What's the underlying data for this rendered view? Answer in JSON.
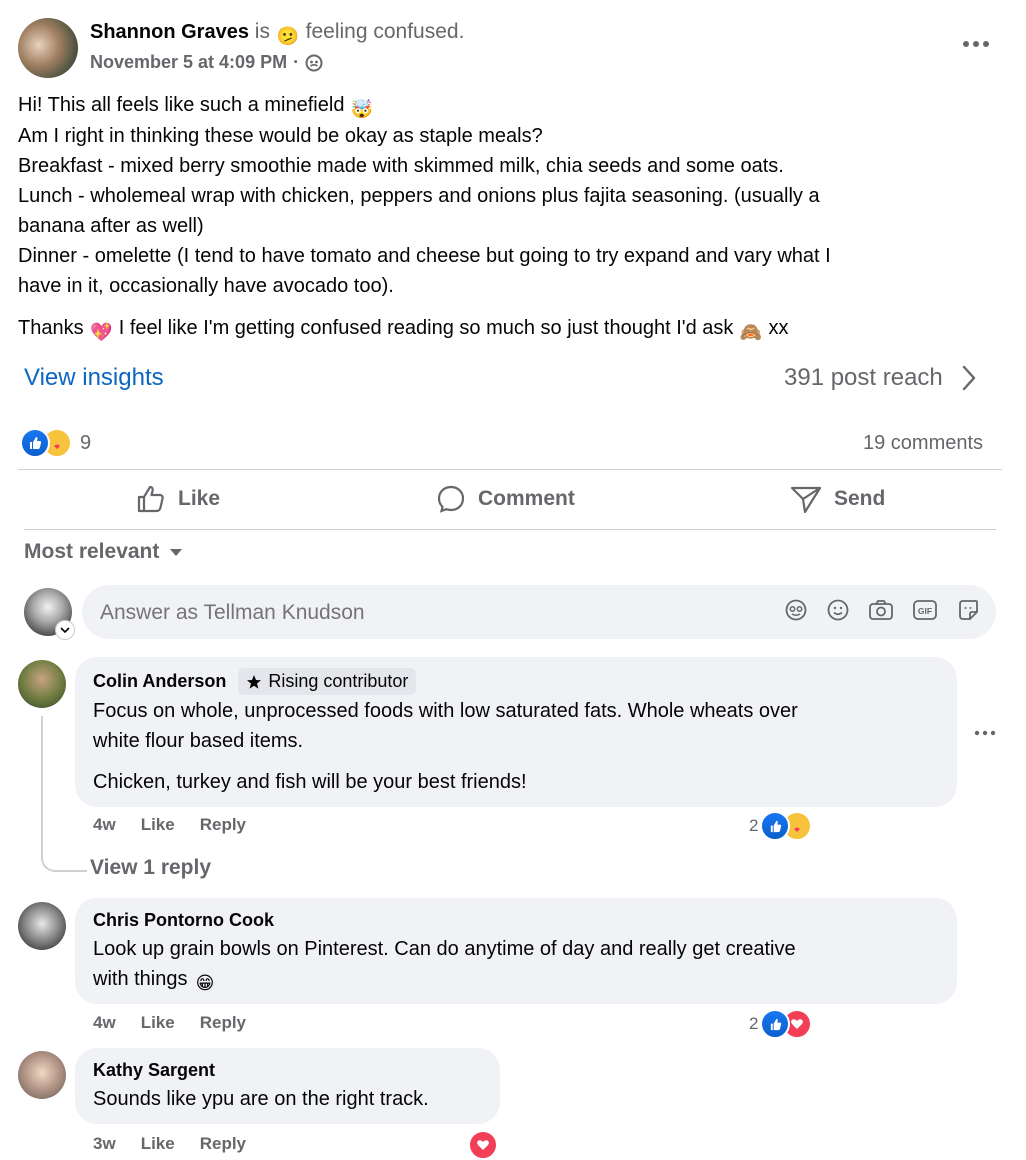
{
  "post": {
    "author": "Shannon Graves",
    "feeling_prefix": "is",
    "feeling_emoji": "🫤",
    "feeling_text": "feeling confused.",
    "timestamp": "November 5 at 4:09 PM",
    "separator": "·",
    "more_icon": "more-horizontal-icon",
    "body": {
      "line1": "Hi! This all feels like such a minefield",
      "line1_emoji": "🤯",
      "line2": "Am I right in thinking these would be okay as staple meals?",
      "line3": "Breakfast - mixed berry smoothie made with skimmed milk, chia seeds and some oats.",
      "line4a": "Lunch - wholemeal wrap with chicken, peppers and onions plus fajita seasoning. (usually a",
      "line4b": "banana after as well)",
      "line5a": "Dinner - omelette (I tend to have tomato and cheese but going to try expand and vary what I",
      "line5b": "have in it, occasionally have avocado too).",
      "thanks_pre": "Thanks",
      "thanks_emoji": "💖",
      "thanks_mid": "I feel like I'm getting confused reading so much so just thought I'd ask",
      "thanks_emoji2": "🙈",
      "thanks_post": "xx"
    },
    "insights_label": "View insights",
    "reach_label": "391 post reach",
    "reaction_count": "9",
    "comments_count": "19 comments"
  },
  "actions": {
    "like": "Like",
    "comment": "Comment",
    "send": "Send"
  },
  "sort_label": "Most relevant",
  "composer": {
    "placeholder": "Answer as Tellman Knudson"
  },
  "comments": [
    {
      "author": "Colin Anderson",
      "badge": "Rising contributor",
      "text1a": "Focus on whole, unprocessed foods with low saturated fats. Whole wheats over",
      "text1b": "white flour based items.",
      "text2": "Chicken, turkey and fish will be your best friends!",
      "time": "4w",
      "like": "Like",
      "reply": "Reply",
      "reactions": "2",
      "view_replies": "View 1 reply"
    },
    {
      "author": "Chris Pontorno Cook",
      "text1a": "Look up grain bowls on Pinterest. Can do anytime of day and really get creative",
      "text1b": "with things",
      "emoji": "😁",
      "time": "4w",
      "like": "Like",
      "reply": "Reply",
      "reactions": "2"
    },
    {
      "author": "Kathy Sargent",
      "text1a": "Sounds like ypu are on the right track.",
      "time": "3w",
      "like": "Like",
      "reply": "Reply"
    }
  ],
  "colors": {
    "link": "#0a66c2",
    "like_blue": "#1877f2",
    "love_red": "#f33e58",
    "bubble_bg": "#f0f2f5",
    "muted": "#65676b"
  }
}
